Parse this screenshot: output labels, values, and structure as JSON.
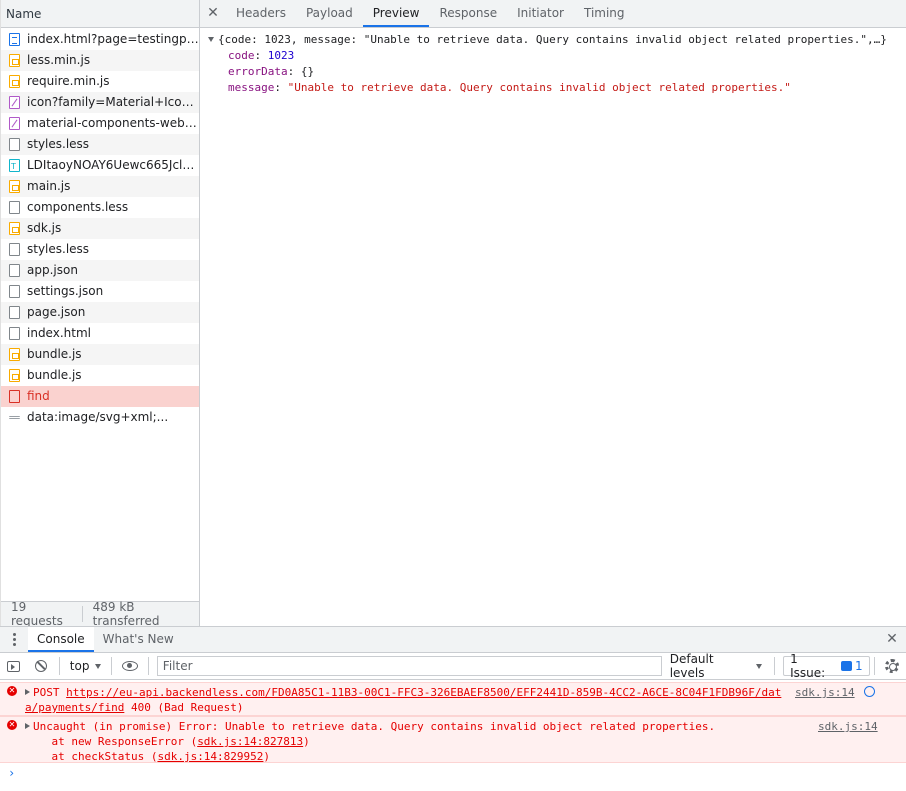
{
  "request_list": {
    "header": "Name",
    "rows": [
      {
        "name": "index.html?page=testingpage2",
        "icon": "doc-icon",
        "status": "ok"
      },
      {
        "name": "less.min.js",
        "icon": "js-icon",
        "status": "ok"
      },
      {
        "name": "require.min.js",
        "icon": "js-icon",
        "status": "ok"
      },
      {
        "name": "icon?family=Material+Icons+...",
        "icon": "font-icon",
        "status": "ok"
      },
      {
        "name": "material-components-web.mi...",
        "icon": "font-icon",
        "status": "ok"
      },
      {
        "name": "styles.less",
        "icon": "file-icon",
        "status": "ok"
      },
      {
        "name": "LDItaoyNOAY6Uewc665JclzCK...",
        "icon": "text-icon",
        "status": "ok"
      },
      {
        "name": "main.js",
        "icon": "js-icon",
        "status": "ok"
      },
      {
        "name": "components.less",
        "icon": "file-icon",
        "status": "ok"
      },
      {
        "name": "sdk.js",
        "icon": "js-icon",
        "status": "ok"
      },
      {
        "name": "styles.less",
        "icon": "file-icon",
        "status": "ok"
      },
      {
        "name": "app.json",
        "icon": "file-icon",
        "status": "ok"
      },
      {
        "name": "settings.json",
        "icon": "file-icon",
        "status": "ok"
      },
      {
        "name": "page.json",
        "icon": "file-icon",
        "status": "ok"
      },
      {
        "name": "index.html",
        "icon": "file-icon",
        "status": "ok"
      },
      {
        "name": "bundle.js",
        "icon": "js-icon",
        "status": "ok"
      },
      {
        "name": "bundle.js",
        "icon": "js-icon",
        "status": "ok"
      },
      {
        "name": "find",
        "icon": "error-file-icon",
        "status": "error"
      },
      {
        "name": "data:image/svg+xml;...",
        "icon": "data-icon",
        "status": "ok"
      }
    ],
    "footer": {
      "requests": "19 requests",
      "transferred": "489 kB transferred"
    }
  },
  "detail": {
    "close_glyph": "✕",
    "tabs": [
      {
        "label": "Headers",
        "active": false
      },
      {
        "label": "Payload",
        "active": false
      },
      {
        "label": "Preview",
        "active": true
      },
      {
        "label": "Response",
        "active": false
      },
      {
        "label": "Initiator",
        "active": false
      },
      {
        "label": "Timing",
        "active": false
      }
    ],
    "preview": {
      "summary": "{code: 1023, message: \"Unable to retrieve data. Query contains invalid object related properties.\",…}",
      "code_key": "code",
      "code_value": "1023",
      "errordata_key": "errorData",
      "errordata_value": "{}",
      "message_key": "message",
      "message_value": "\"Unable to retrieve data. Query contains invalid object related properties.\""
    }
  },
  "drawer": {
    "tabs": [
      {
        "label": "Console",
        "active": true
      },
      {
        "label": "What's New",
        "active": false
      }
    ],
    "close_glyph": "✕",
    "toolbar": {
      "context": "top",
      "filter_placeholder": "Filter",
      "levels": "Default levels",
      "issues_label": "1 Issue:",
      "issues_count": "1"
    },
    "messages": [
      {
        "method": "POST",
        "url_line1": "https://eu-api.backendless.com/FD0A85C1-11B3-00C1-FFC3-326EBAEF8500/EFF2441D-859B-4CC2-A6CE-8C04F1FDB96F/dat",
        "url_line2": "a/payments/find",
        "status_text": " 400 (Bad Request)",
        "source": "sdk.js:14"
      },
      {
        "text": "Uncaught (in promise) Error: Unable to retrieve data. Query contains invalid object related properties.",
        "stack1_prefix": "    at new ResponseError (",
        "stack1_link": "sdk.js:14:827813",
        "stack1_suffix": ")",
        "stack2_prefix": "    at checkStatus (",
        "stack2_link": "sdk.js:14:829952",
        "stack2_suffix": ")",
        "source": "sdk.js:14"
      }
    ],
    "prompt": "›"
  },
  "colors": {
    "accent": "#1a73e8",
    "error": "#e50000",
    "error_row_bg": "#fad2cf"
  }
}
